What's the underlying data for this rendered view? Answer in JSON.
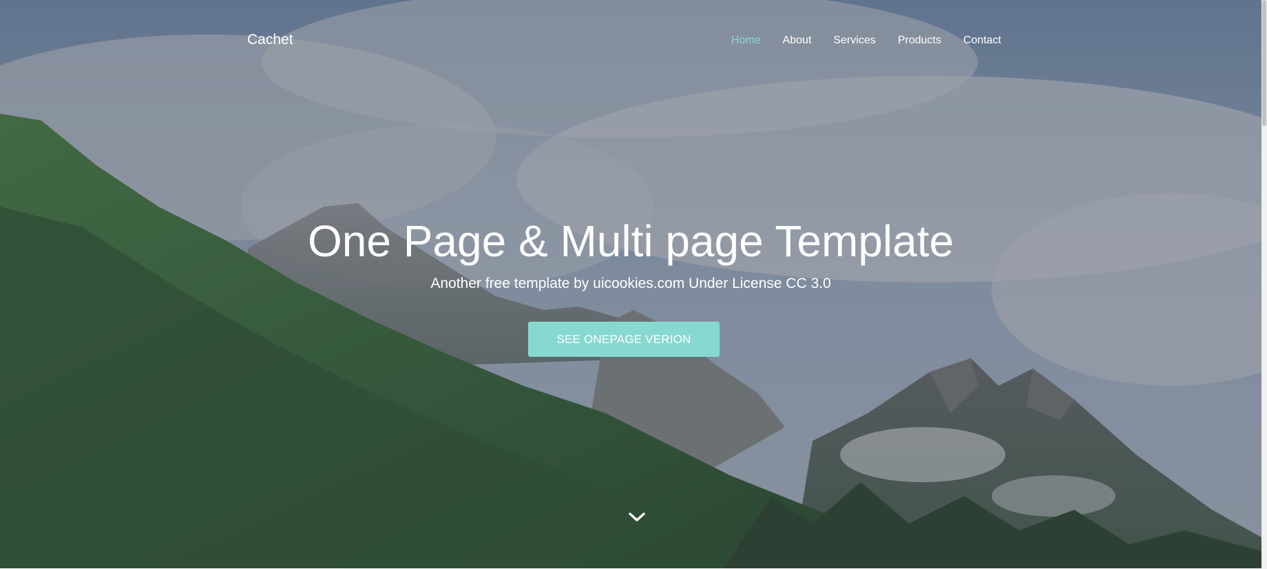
{
  "brand": {
    "name": "Cachet"
  },
  "nav": {
    "items": [
      {
        "label": "Home",
        "active": true
      },
      {
        "label": "About",
        "active": false
      },
      {
        "label": "Services",
        "active": false
      },
      {
        "label": "Products",
        "active": false
      },
      {
        "label": "Contact",
        "active": false
      }
    ]
  },
  "hero": {
    "title": "One Page & Multi page Template",
    "subtitle": "Another free template by uicookies.com Under License CC 3.0",
    "cta_label": "SEE ONEPAGE VERION",
    "scroll_icon": "chevron-down-icon",
    "background_image": "mountain-forest-photo"
  },
  "colors": {
    "accent": "#87d9d0",
    "active_link": "#8dd9d0",
    "text": "#ffffff"
  }
}
